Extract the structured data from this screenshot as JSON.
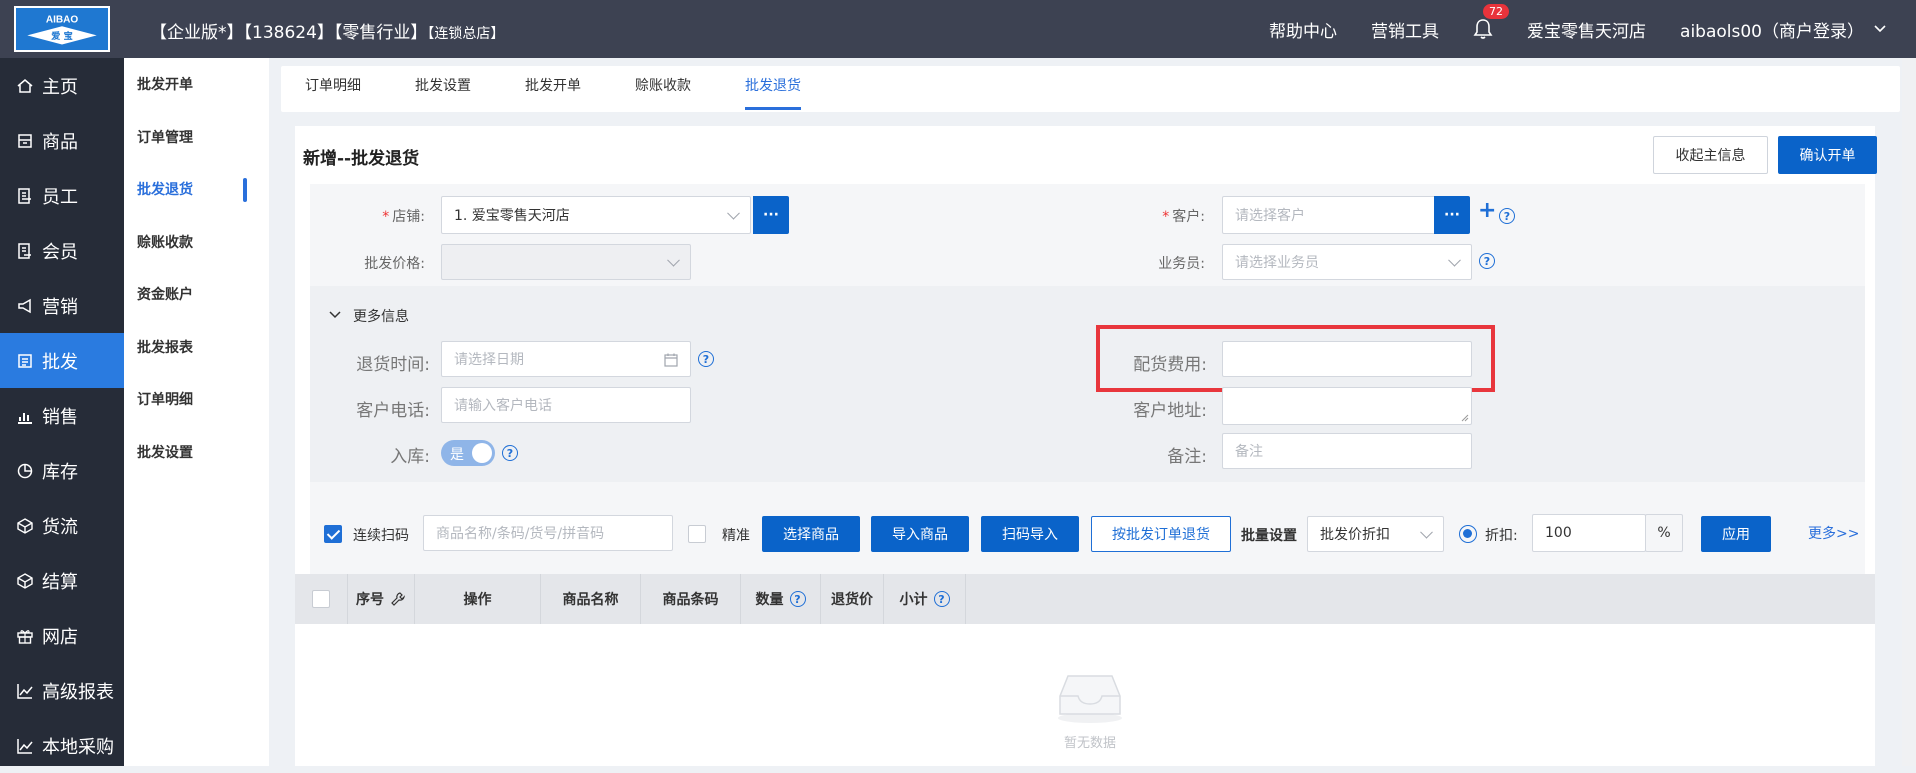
{
  "header": {
    "logo_top": "AIBAO",
    "logo_bottom": "爱 宝",
    "title_main": "【企业版*】【138624】【零售行业】",
    "title_small": "【连锁总店】",
    "help_center": "帮助中心",
    "marketing_tools": "营销工具",
    "notification_count": "72",
    "store_name": "爱宝零售天河店",
    "user": "aibaols00（商户登录）"
  },
  "leftnav": {
    "items": [
      {
        "label": "主页",
        "icon": "home-icon"
      },
      {
        "label": "商品",
        "icon": "goods-icon"
      },
      {
        "label": "员工",
        "icon": "staff-icon"
      },
      {
        "label": "会员",
        "icon": "member-icon"
      },
      {
        "label": "营销",
        "icon": "megaphone-icon"
      },
      {
        "label": "批发",
        "icon": "wholesale-icon"
      },
      {
        "label": "销售",
        "icon": "sales-chart-icon"
      },
      {
        "label": "库存",
        "icon": "pie-chart-icon"
      },
      {
        "label": "货流",
        "icon": "cube-icon"
      },
      {
        "label": "结算",
        "icon": "settle-icon"
      },
      {
        "label": "网店",
        "icon": "gift-icon"
      },
      {
        "label": "高级报表",
        "icon": "trend-icon"
      },
      {
        "label": "本地采购",
        "icon": "trend-icon"
      }
    ],
    "active_index": 5
  },
  "subnav": {
    "items": [
      "批发开单",
      "订单管理",
      "批发退货",
      "赊账收款",
      "资金账户",
      "批发报表",
      "订单明细",
      "批发设置"
    ],
    "active_index": 2
  },
  "tabs": [
    "订单明细",
    "批发设置",
    "批发开单",
    "赊账收款",
    "批发退货"
  ],
  "active_tab": 4,
  "page": {
    "title": "新增--批发退货",
    "collapse_btn": "收起主信息",
    "confirm_btn": "确认开单"
  },
  "form": {
    "store_label": "店铺:",
    "store_value": "1. 爱宝零售天河店",
    "ellipsis": "···",
    "customer_label": "客户:",
    "customer_placeholder": "请选择客户",
    "price_label": "批发价格:",
    "salesman_label": "业务员:",
    "salesman_placeholder": "请选择业务员",
    "more_info": "更多信息",
    "return_time_label": "退货时间:",
    "return_time_placeholder": "请选择日期",
    "delivery_fee_label": "配货费用:",
    "phone_label": "客户电话:",
    "phone_placeholder": "请输入客户电话",
    "address_label": "客户地址:",
    "stock_label": "入库:",
    "stock_toggle": "是",
    "remark_label": "备注:",
    "remark_placeholder": "备注"
  },
  "toolbar": {
    "continuous_scan": "连续扫码",
    "search_placeholder": "商品名称/条码/货号/拼音码",
    "exact": "精准",
    "select_goods": "选择商品",
    "import_goods": "导入商品",
    "scan_import": "扫码导入",
    "return_by_order": "按批发订单退货",
    "batch_settings": "批量设置",
    "batch_select": "批发价折扣",
    "discount_label": "折扣:",
    "discount_value": "100",
    "percent": "%",
    "apply": "应用",
    "more": "更多>>"
  },
  "table": {
    "columns": [
      "序号",
      "操作",
      "商品名称",
      "商品条码",
      "数量",
      "退货价",
      "小计"
    ],
    "empty_text": "暂无数据"
  },
  "colors": {
    "primary": "#0a63c9",
    "nav_active": "#2a7be0",
    "highlight": "#e8363c"
  }
}
